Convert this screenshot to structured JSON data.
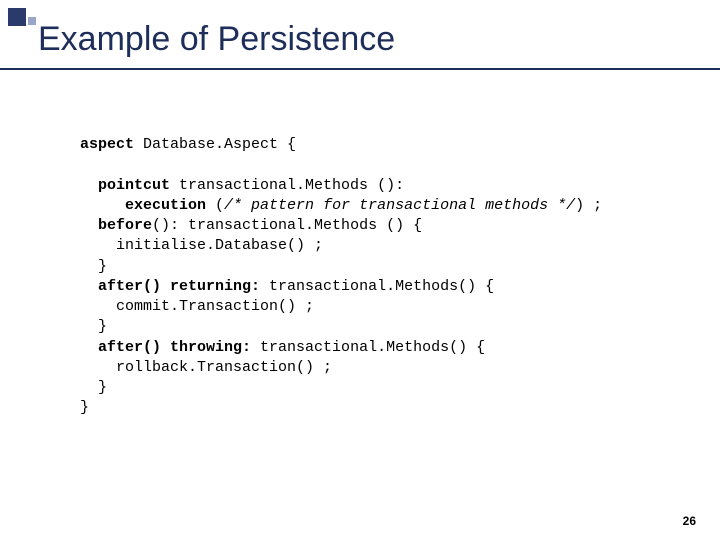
{
  "slide": {
    "title": "Example of Persistence",
    "page_number": "26"
  },
  "code": {
    "kw_aspect": "aspect",
    "aspect_name_open": " Database.Aspect {",
    "kw_pointcut": "pointcut",
    "pointcut_decl": " transactional.Methods ():",
    "kw_execution": "execution",
    "exec_open": " (",
    "exec_comment": "/* pattern for transactional methods */",
    "exec_close": ") ;",
    "kw_before": "before",
    "before_decl": "(): transactional.Methods () {",
    "init_db": "initialise.Database() ;",
    "brace_close1": "}",
    "kw_after_ret": "after() returning:",
    "after_ret_decl": " transactional.Methods() {",
    "commit": "commit.Transaction() ;",
    "brace_close2": "}",
    "kw_after_throw": "after() throwing:",
    "after_throw_decl": " transactional.Methods() {",
    "rollback": "rollback.Transaction() ;",
    "brace_close3": "}",
    "brace_close4": "}"
  }
}
